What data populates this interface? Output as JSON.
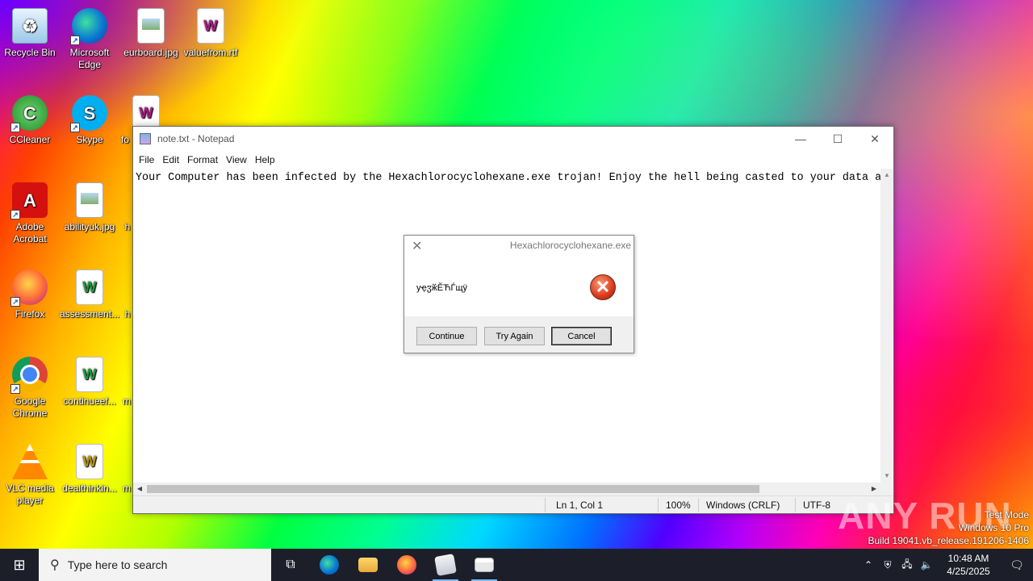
{
  "desktop": {
    "icons": [
      {
        "label": "Recycle Bin"
      },
      {
        "label": "Microsoft Edge"
      },
      {
        "label": "eurboard.jpg"
      },
      {
        "label": "valuefrom.rtf"
      },
      {
        "label": "CCleaner"
      },
      {
        "label": "Skype"
      },
      {
        "label": "fo"
      },
      {
        "label": "Adobe Acrobat"
      },
      {
        "label": "abilityuk.jpg"
      },
      {
        "label": "h"
      },
      {
        "label": "Firefox"
      },
      {
        "label": "assessment..."
      },
      {
        "label": "h"
      },
      {
        "label": "Google Chrome"
      },
      {
        "label": "continueef..."
      },
      {
        "label": "m"
      },
      {
        "label": "VLC media player"
      },
      {
        "label": "dealthinkin..."
      },
      {
        "label": "m"
      }
    ]
  },
  "notepad": {
    "title": "note.txt - Notepad",
    "menu": [
      "File",
      "Edit",
      "Format",
      "View",
      "Help"
    ],
    "content": "Your Computer has been infected by the Hexachlorocyclohexane.exe trojan! Enjoy the hell being casted to your data a",
    "status": {
      "position": "Ln 1, Col 1",
      "zoom": "100%",
      "line_ending": "Windows (CRLF)",
      "encoding": "UTF-8"
    }
  },
  "dialog": {
    "title": "Hexachlorocyclohexane.exe",
    "message": "уҿჳӂӖЋЃщӱ",
    "buttons": [
      "Continue",
      "Try Again",
      "Cancel"
    ]
  },
  "watermark": {
    "brand": "ANY RUN",
    "line1": "Test Mode",
    "line2": "Windows 10 Pro",
    "line3": "Build 19041.vb_release.191206-1406"
  },
  "taskbar": {
    "search_placeholder": "Type here to search",
    "time": "10:48 AM",
    "date": "4/25/2025"
  },
  "colors": {
    "taskbar_bg": "#1c1f2a",
    "error_red": "#d93a1a",
    "active_indicator": "#7ab8f5"
  }
}
